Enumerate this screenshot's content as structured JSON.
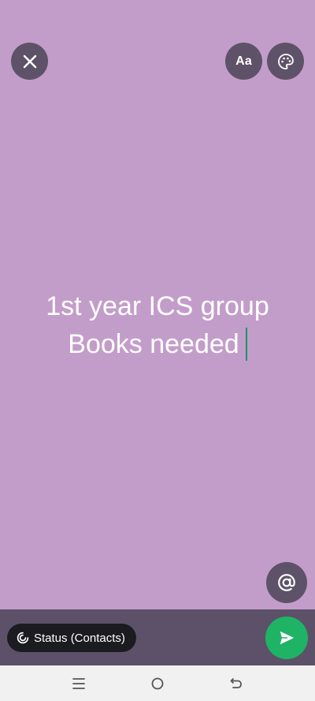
{
  "status_editor": {
    "text_lines": [
      "1st year ICS group",
      "Books needed"
    ],
    "background_color": "#c39dca"
  },
  "toolbar": {
    "font_label": "Aa"
  },
  "footer": {
    "audience_label": "Status (Contacts)"
  },
  "icons": {
    "close": "close-icon",
    "font": "font-icon",
    "palette": "palette-icon",
    "mention": "at-icon",
    "audience": "status-icon",
    "send": "send-icon",
    "nav_menu": "recent-apps-icon",
    "nav_home": "home-icon",
    "nav_back": "back-icon"
  },
  "colors": {
    "button_bg": "#5e5268",
    "send_green": "#1fb366",
    "caret": "#1f8f6a",
    "chip_bg": "#1c1b1f"
  }
}
